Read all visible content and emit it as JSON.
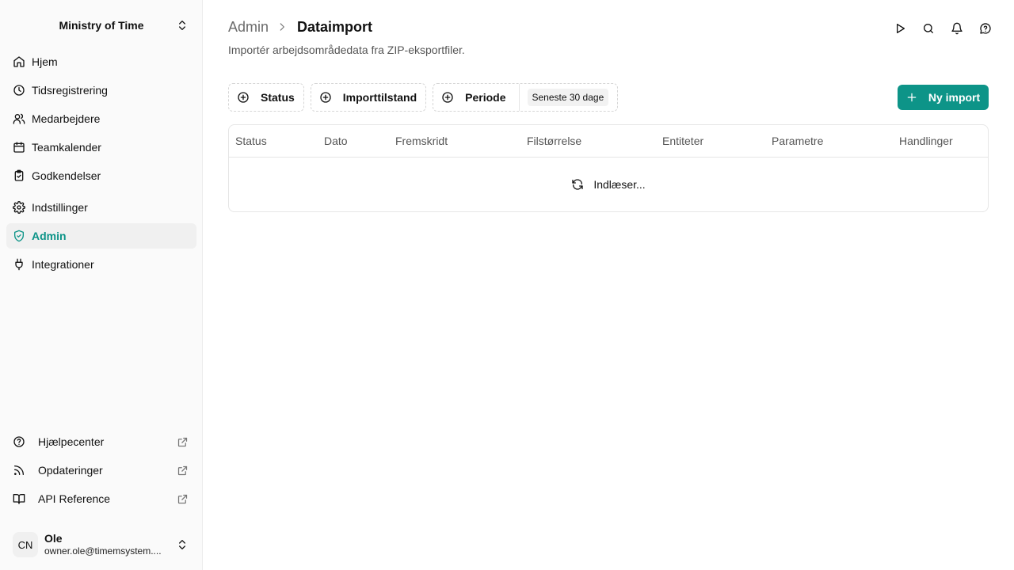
{
  "workspace": {
    "name": "Ministry of Time"
  },
  "nav": [
    {
      "label": "Hjem",
      "icon": "home-icon"
    },
    {
      "label": "Tidsregistrering",
      "icon": "clock-icon"
    },
    {
      "label": "Medarbejdere",
      "icon": "users-icon"
    },
    {
      "label": "Teamkalender",
      "icon": "calendar-icon"
    },
    {
      "label": "Godkendelser",
      "icon": "clipboard-check-icon"
    },
    {
      "label": "Indstillinger",
      "icon": "gear-icon"
    },
    {
      "label": "Admin",
      "icon": "shield-check-icon",
      "active": true
    },
    {
      "label": "Integrationer",
      "icon": "plug-icon"
    }
  ],
  "external_links": [
    {
      "label": "Hjælpecenter",
      "icon": "help-circle-icon"
    },
    {
      "label": "Opdateringer",
      "icon": "rss-icon"
    },
    {
      "label": "API Reference",
      "icon": "book-open-icon"
    }
  ],
  "user": {
    "initials": "CN",
    "name": "Ole",
    "email": "owner.ole@timemsystem...."
  },
  "header": {
    "breadcrumb_parent": "Admin",
    "breadcrumb_current": "Dataimport",
    "subtitle": "Importér arbejdsområdedata fra ZIP-eksportfiler."
  },
  "top_icons": [
    "play-icon",
    "search-icon",
    "bell-icon",
    "help-chat-icon"
  ],
  "filters": {
    "status": "Status",
    "import_state": "Importtilstand",
    "period": "Periode",
    "period_value": "Seneste 30 dage"
  },
  "new_import_label": "Ny import",
  "table": {
    "columns": [
      "Status",
      "Dato",
      "Fremskridt",
      "Filstørrelse",
      "Entiteter",
      "Parametre",
      "Handlinger"
    ],
    "loading_text": "Indlæser..."
  },
  "colors": {
    "accent": "#0d9488"
  }
}
